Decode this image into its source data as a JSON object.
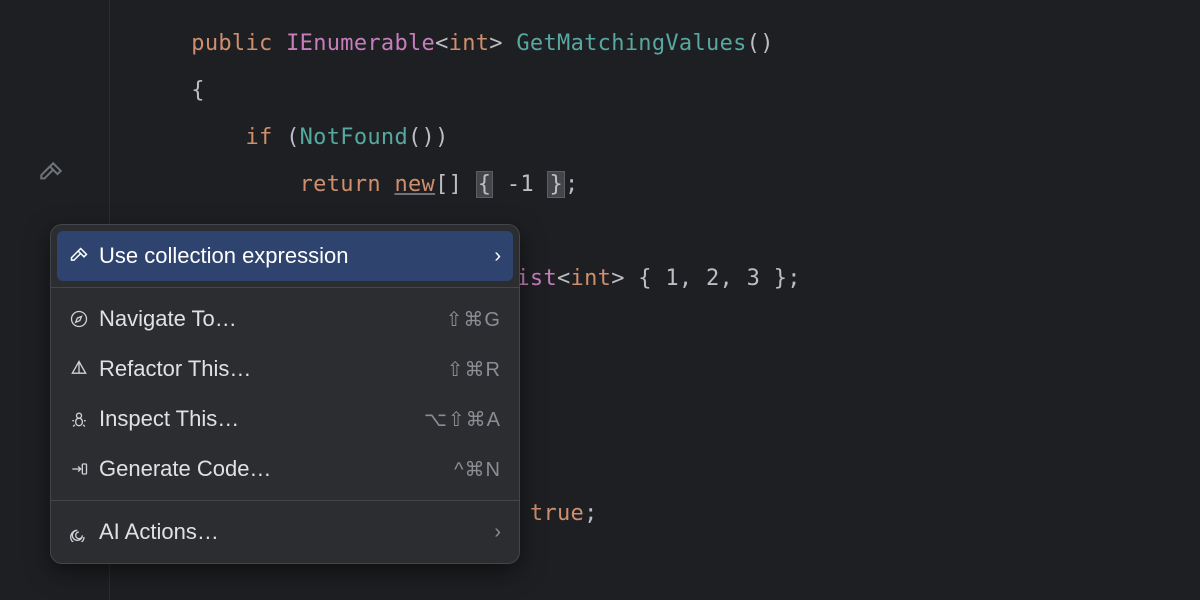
{
  "code": {
    "kw_public": "public",
    "type_ienum": "IEnumerable",
    "type_int": "int",
    "method_name": "GetMatchingValues",
    "brace_open": "{",
    "kw_if": "if",
    "method_notfound": "NotFound",
    "kw_return": "return",
    "kw_new": "new",
    "arr_suffix": "[]",
    "val_minus1": "-1",
    "type_list": "List",
    "vals_123": "1, 2, 3",
    "bool_true": "true",
    "semi": ";",
    "brace_close": "}"
  },
  "popup": {
    "items": [
      {
        "label": "Use collection expression",
        "shortcut": "",
        "arrow": true
      },
      {
        "label": "Navigate To…",
        "shortcut": "⇧⌘G",
        "arrow": false
      },
      {
        "label": "Refactor This…",
        "shortcut": "⇧⌘R",
        "arrow": false
      },
      {
        "label": "Inspect This…",
        "shortcut": "⌥⇧⌘A",
        "arrow": false
      },
      {
        "label": "Generate Code…",
        "shortcut": "^⌘N",
        "arrow": false
      },
      {
        "label": "AI Actions…",
        "shortcut": "",
        "arrow": true
      }
    ]
  }
}
